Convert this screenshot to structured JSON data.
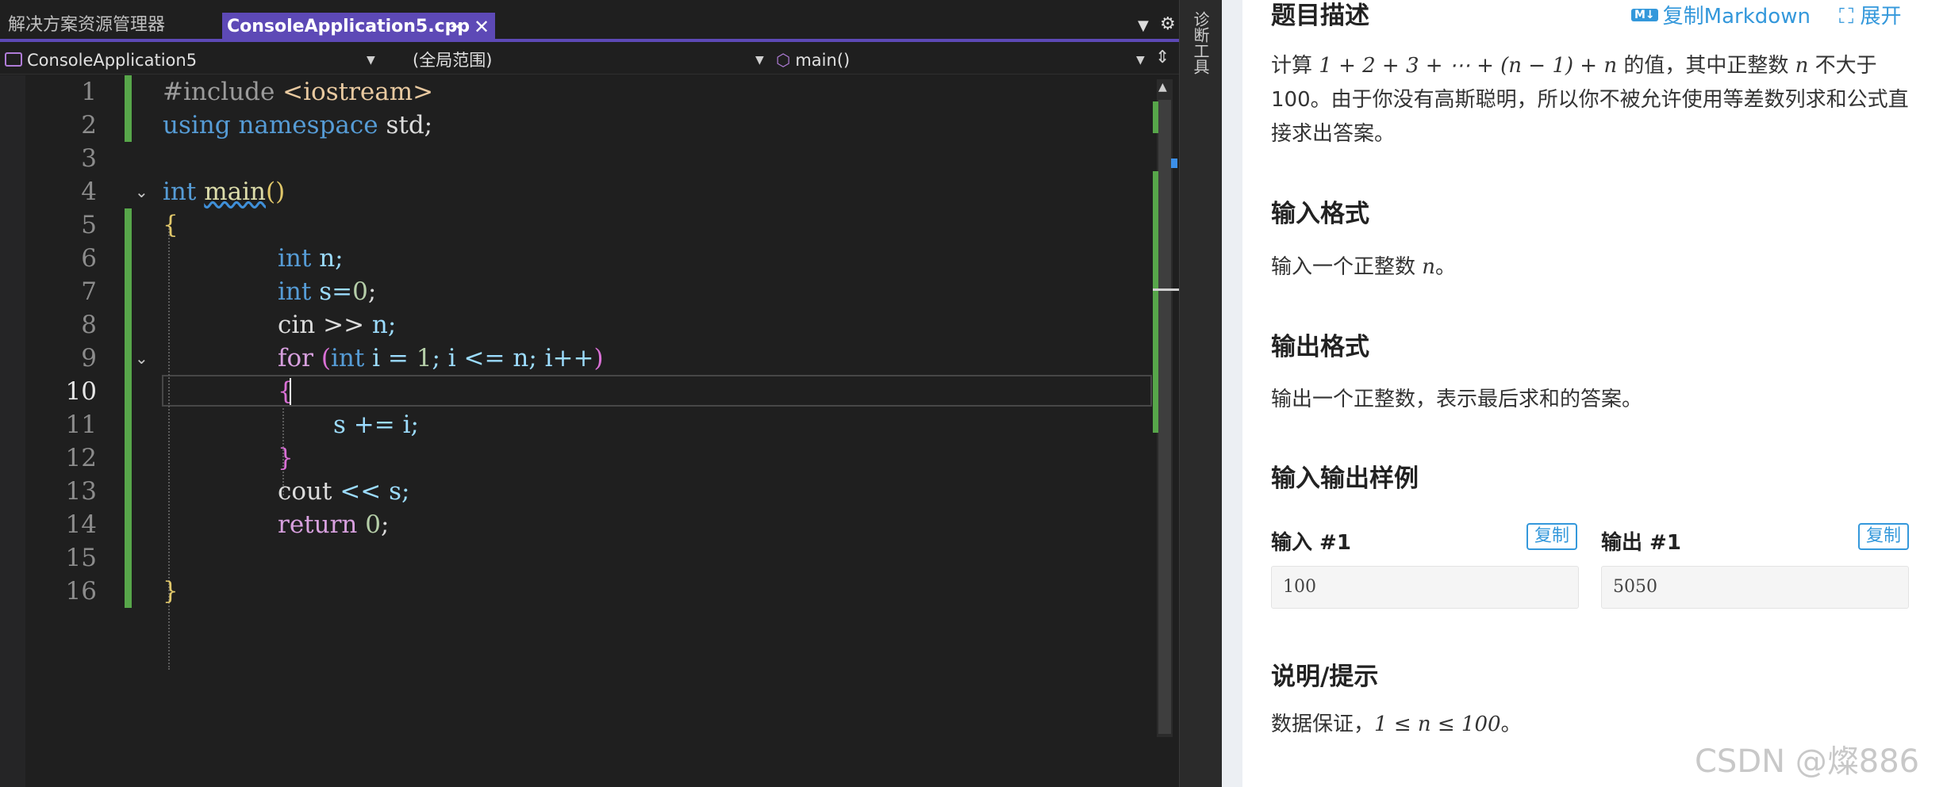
{
  "ide": {
    "tabs": {
      "solution_explorer": "解决方案资源管理器",
      "file": "ConsoleApplication5.cpp",
      "pin_glyph": "⊸",
      "close_glyph": "✕"
    },
    "nav": {
      "project": "ConsoleApplication5",
      "scope": "(全局范围)",
      "member": "main()"
    },
    "side_panel_label": "诊断工具",
    "line_numbers": [
      "1",
      "2",
      "3",
      "4",
      "5",
      "6",
      "7",
      "8",
      "9",
      "10",
      "11",
      "12",
      "13",
      "14",
      "15",
      "16"
    ],
    "code": {
      "l1_directive": "#include",
      "l1_header": "<iostream>",
      "l2_using": "using",
      "l2_namespace": "namespace",
      "l2_std": "std;",
      "l4_int": "int",
      "l4_main": "main",
      "l4_parens": "()",
      "l5_brace": "{",
      "l6_int": "int",
      "l6_rest": "n;",
      "l7_int": "int",
      "l7_s": "s=",
      "l7_zero": "0",
      "l7_semi": ";",
      "l8_cin": "cin",
      "l8_op": ">>",
      "l8_rest": "n;",
      "l9_for": "for",
      "l9_open": "(",
      "l9_int": "int",
      "l9_i": "i =",
      "l9_one": "1",
      "l9_rest": "; i <= n; i++",
      "l9_close": ")",
      "l10_brace": "{",
      "l11": "s += i;",
      "l12_brace": "}",
      "l13_cout": "cout",
      "l13_rest": "<< s;",
      "l14_return": "return",
      "l14_zero": "0",
      "l14_semi": ";",
      "l16_brace": "}"
    },
    "active_line": 10
  },
  "problem": {
    "title": "题目描述",
    "copy_markdown": "复制Markdown",
    "markdown_badge": "M↓",
    "expand": "展开",
    "desc_before": "计算 ",
    "desc_math": "1 + 2 + 3 + ⋯ + (n − 1) + n",
    "desc_mid": " 的值，其中正整数 ",
    "desc_n": "n",
    "desc_after": " 不大于 100。由于你没有高斯聪明，所以你不被允许使用等差数列求和公式直接求出答案。",
    "input_heading": "输入格式",
    "input_text_before": "输入一个正整数 ",
    "input_text_n": "n",
    "input_text_after": "。",
    "output_heading": "输出格式",
    "output_text": "输出一个正整数，表示最后求和的答案。",
    "samples_heading": "输入输出样例",
    "input_label": "输入 #1",
    "output_label": "输出 #1",
    "copy": "复制",
    "sample_input": "100",
    "sample_output": "5050",
    "hint_heading": "说明/提示",
    "hint_before": "数据保证，",
    "hint_math": "1 ≤ n ≤ 100",
    "hint_after": "。"
  },
  "watermark": "CSDN @燦886"
}
